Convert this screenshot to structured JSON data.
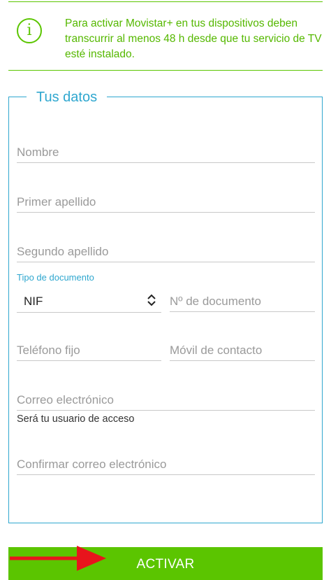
{
  "info": {
    "message": "Para activar Movistar+ en tus dispositivos deben transcurrir al menos 48 h desde que tu servicio de TV esté instalado.",
    "icon": "info-icon"
  },
  "form": {
    "legend": "Tus datos",
    "nombre_placeholder": "Nombre",
    "primer_apellido_placeholder": "Primer apellido",
    "segundo_apellido_placeholder": "Segundo apellido",
    "tipo_documento_label": "Tipo de documento",
    "tipo_documento_value": "NIF",
    "numero_documento_placeholder": "Nº de documento",
    "telefono_fijo_placeholder": "Teléfono fijo",
    "movil_placeholder": "Móvil de contacto",
    "correo_placeholder": "Correo electrónico",
    "correo_helper": "Será tu usuario de acceso",
    "confirmar_correo_placeholder": "Confirmar correo electrónico"
  },
  "actions": {
    "activar_label": "ACTIVAR"
  },
  "colors": {
    "brand_green": "#5bc500",
    "accent_blue": "#2fa7cf",
    "annotation_red": "#e8141c"
  }
}
